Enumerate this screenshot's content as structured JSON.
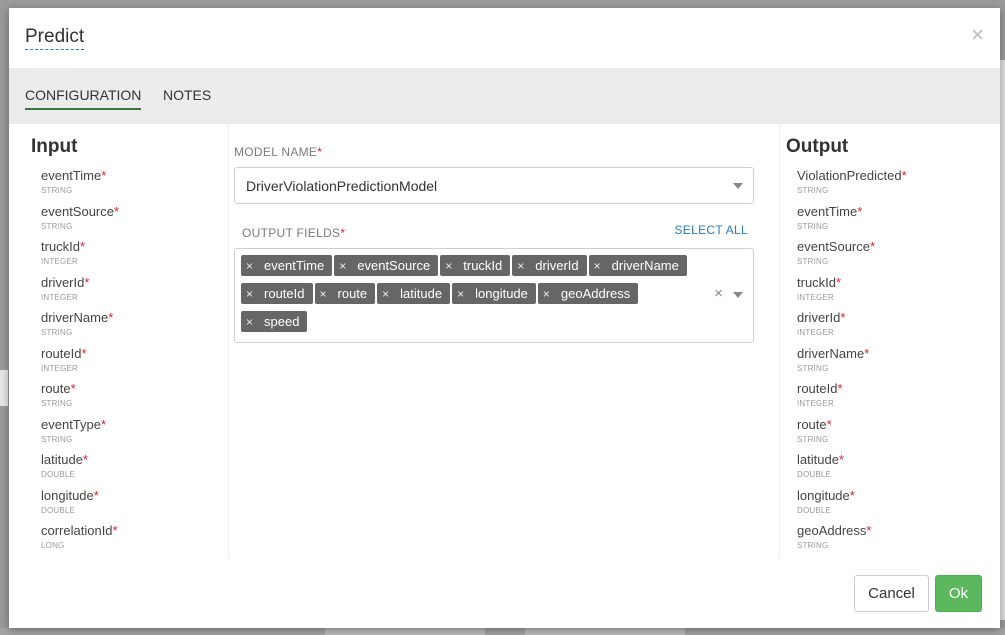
{
  "modal": {
    "title": "Predict",
    "close_icon": "×"
  },
  "tabs": [
    {
      "label": "CONFIGURATION",
      "active": true
    },
    {
      "label": "NOTES",
      "active": false
    }
  ],
  "input": {
    "title": "Input",
    "fields": [
      {
        "name": "eventTime",
        "type": "STRING"
      },
      {
        "name": "eventSource",
        "type": "STRING"
      },
      {
        "name": "truckId",
        "type": "INTEGER"
      },
      {
        "name": "driverId",
        "type": "INTEGER"
      },
      {
        "name": "driverName",
        "type": "STRING"
      },
      {
        "name": "routeId",
        "type": "INTEGER"
      },
      {
        "name": "route",
        "type": "STRING"
      },
      {
        "name": "eventType",
        "type": "STRING"
      },
      {
        "name": "latitude",
        "type": "DOUBLE"
      },
      {
        "name": "longitude",
        "type": "DOUBLE"
      },
      {
        "name": "correlationId",
        "type": "LONG"
      }
    ]
  },
  "config": {
    "model_name_label": "MODEL NAME",
    "model_name_value": "DriverViolationPredictionModel",
    "output_fields_label": "OUTPUT FIELDS",
    "select_all_label": "SELECT ALL",
    "required_mark": "*",
    "clear_icon": "×",
    "chip_remove_icon": "×",
    "output_fields": [
      "eventTime",
      "eventSource",
      "truckId",
      "driverId",
      "driverName",
      "routeId",
      "route",
      "latitude",
      "longitude",
      "geoAddress",
      "speed"
    ]
  },
  "output": {
    "title": "Output",
    "fields": [
      {
        "name": "ViolationPredicted",
        "type": "STRING"
      },
      {
        "name": "eventTime",
        "type": "STRING"
      },
      {
        "name": "eventSource",
        "type": "STRING"
      },
      {
        "name": "truckId",
        "type": "INTEGER"
      },
      {
        "name": "driverId",
        "type": "INTEGER"
      },
      {
        "name": "driverName",
        "type": "STRING"
      },
      {
        "name": "routeId",
        "type": "INTEGER"
      },
      {
        "name": "route",
        "type": "STRING"
      },
      {
        "name": "latitude",
        "type": "DOUBLE"
      },
      {
        "name": "longitude",
        "type": "DOUBLE"
      },
      {
        "name": "geoAddress",
        "type": "STRING"
      }
    ]
  },
  "footer": {
    "cancel_label": "Cancel",
    "ok_label": "Ok"
  },
  "colors": {
    "ok_button": "#5cb85c",
    "required": "#d9232d",
    "link": "#2b7bb9",
    "chip": "#666666"
  }
}
